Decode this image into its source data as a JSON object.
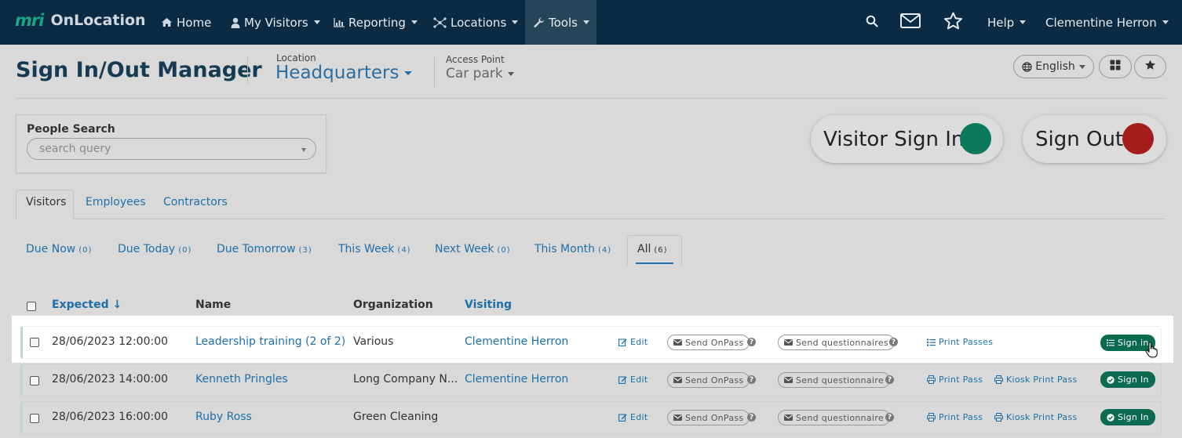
{
  "nav": {
    "logo_mark": "mri",
    "logo_name": "OnLocation",
    "home": "Home",
    "my_visitors": "My Visitors",
    "reporting": "Reporting",
    "locations": "Locations",
    "tools": "Tools",
    "help": "Help",
    "user": "Clementine Herron"
  },
  "header": {
    "title": "Sign In/Out Manager",
    "location_label": "Location",
    "location_value": "Headquarters",
    "access_point_label": "Access Point",
    "access_point_value": "Car park",
    "language": "English"
  },
  "search": {
    "label": "People Search",
    "placeholder": "search query"
  },
  "actions": {
    "visitor_sign_in": "Visitor Sign In",
    "sign_out": "Sign Out",
    "sign_in_color": "#0a7a5a",
    "sign_out_color": "#a51c1c"
  },
  "tabs": [
    "Visitors",
    "Employees",
    "Contractors"
  ],
  "filters": [
    {
      "label": "Due Now",
      "count": "(0)"
    },
    {
      "label": "Due Today",
      "count": "(0)"
    },
    {
      "label": "Due Tomorrow",
      "count": "(3)"
    },
    {
      "label": "This Week",
      "count": "(4)"
    },
    {
      "label": "Next Week",
      "count": "(0)"
    },
    {
      "label": "This Month",
      "count": "(4)"
    },
    {
      "label": "All",
      "count": "(6)"
    }
  ],
  "table": {
    "headers": {
      "expected": "Expected ↓",
      "name": "Name",
      "organization": "Organization",
      "visiting": "Visiting"
    },
    "rows": [
      {
        "expected": "28/06/2023 12:00:00",
        "name": "Leadership training (2 of 2)",
        "organization": "Various",
        "visiting": "Clementine Herron",
        "edit": "Edit",
        "send_onpass": "Send OnPass",
        "send_questionnaires": "Send questionnaires",
        "print": "Print Passes",
        "kiosk": "",
        "sign_in": "Sign in"
      },
      {
        "expected": "28/06/2023 14:00:00",
        "name": "Kenneth Pringles",
        "organization": "Long Company N...",
        "visiting": "Clementine Herron",
        "edit": "Edit",
        "send_onpass": "Send OnPass",
        "send_questionnaires": "Send questionnaire",
        "print": "Print Pass",
        "kiosk": "Kiosk Print Pass",
        "sign_in": "Sign In"
      },
      {
        "expected": "28/06/2023 16:00:00",
        "name": "Ruby Ross",
        "organization": "Green Cleaning",
        "visiting": "",
        "edit": "Edit",
        "send_onpass": "Send OnPass",
        "send_questionnaires": "Send questionnaire",
        "print": "Print Pass",
        "kiosk": "Kiosk Print Pass",
        "sign_in": "Sign In"
      }
    ]
  }
}
